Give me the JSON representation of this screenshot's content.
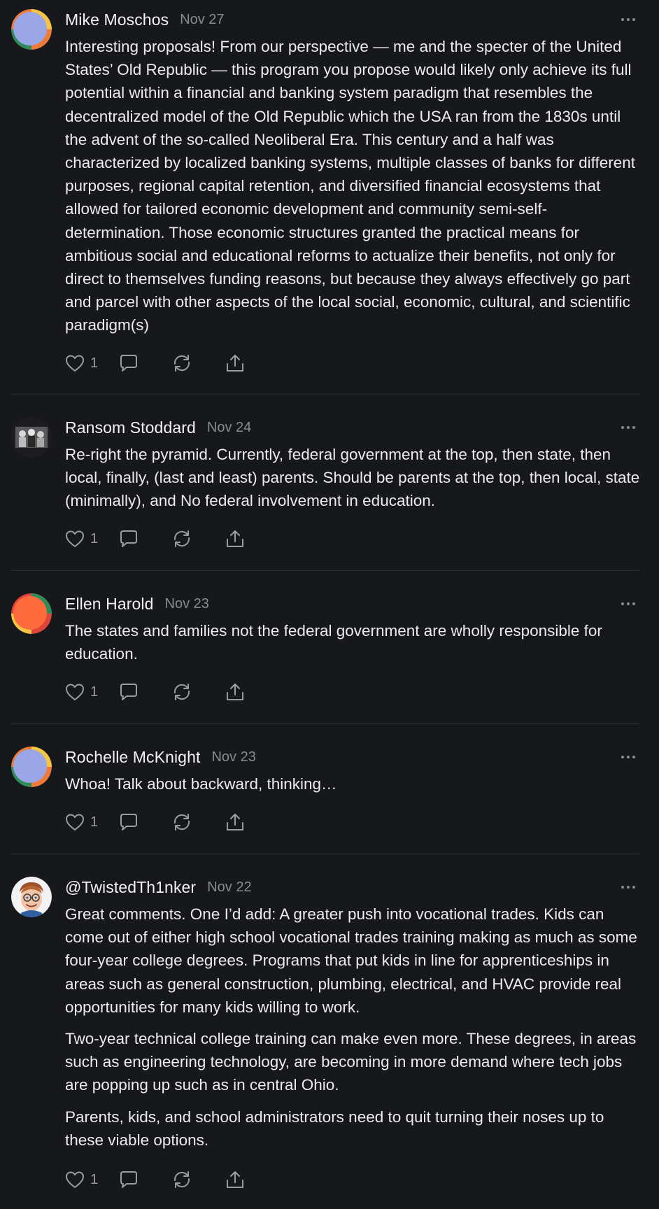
{
  "comments": [
    {
      "author": "Mike Moschos",
      "date": "Nov 27",
      "avatar_icon": "gradient-avatar-icon",
      "paragraphs": [
        "Interesting proposals! From our perspective — me and the specter of the United States’ Old Republic — this program you propose would likely only achieve its full potential within a financial and banking system paradigm that resembles the decentralized model of the Old Republic which the USA ran from the 1830s until the advent of the so-called Neoliberal Era. This century and a half was characterized by localized banking systems, multiple classes of banks for different purposes, regional capital retention, and diversified financial ecosystems that allowed for tailored economic development and community semi-self-determination. Those economic structures granted the practical means for ambitious social and educational reforms to actualize their benefits, not only for direct to themselves funding reasons, but because they always effectively go part and parcel with other aspects of the local social, economic, cultural, and scientific paradigm(s)"
      ],
      "likes": "1"
    },
    {
      "author": "Ransom Stoddard",
      "date": "Nov 24",
      "avatar_icon": "photo-avatar-icon",
      "paragraphs": [
        "Re-right the pyramid. Currently, federal government at the top, then state, then local, finally, (last and least) parents. Should be parents at the top, then local, state (minimally), and No federal involvement in education."
      ],
      "likes": "1"
    },
    {
      "author": "Ellen Harold",
      "date": "Nov 23",
      "avatar_icon": "gradient-avatar-icon",
      "paragraphs": [
        "The states and families not the federal government are wholly responsible for education."
      ],
      "likes": "1"
    },
    {
      "author": "Rochelle McKnight",
      "date": "Nov 23",
      "avatar_icon": "gradient-avatar-icon",
      "paragraphs": [
        "Whoa! Talk about backward, thinking…"
      ],
      "likes": "1"
    },
    {
      "author": "@TwistedTh1nker",
      "date": "Nov 22",
      "avatar_icon": "cartoon-avatar-icon",
      "paragraphs": [
        "Great comments. One I’d add: A greater push into vocational trades. Kids can come out of either high school vocational trades training making as much as some four-year college degrees. Programs that put kids in line for apprenticeships in areas such as general construction, plumbing, electrical, and HVAC provide real opportunities for many kids willing to work.",
        "Two-year technical college training can make even more. These degrees, in areas such as engineering technology, are becoming in more demand where tech jobs are popping up such as in central Ohio.",
        "Parents, kids, and school administrators need to quit turning their noses up to these viable options."
      ],
      "likes": "1"
    }
  ],
  "icons": {
    "like": "heart-icon",
    "comment": "speech-bubble-icon",
    "repost": "repost-arrows-icon",
    "share": "share-upload-icon",
    "more": "ellipsis-icon"
  },
  "colors": {
    "background": "#17181b",
    "text": "#ececee",
    "muted": "#8a8b90",
    "divider": "#2c2d31"
  }
}
